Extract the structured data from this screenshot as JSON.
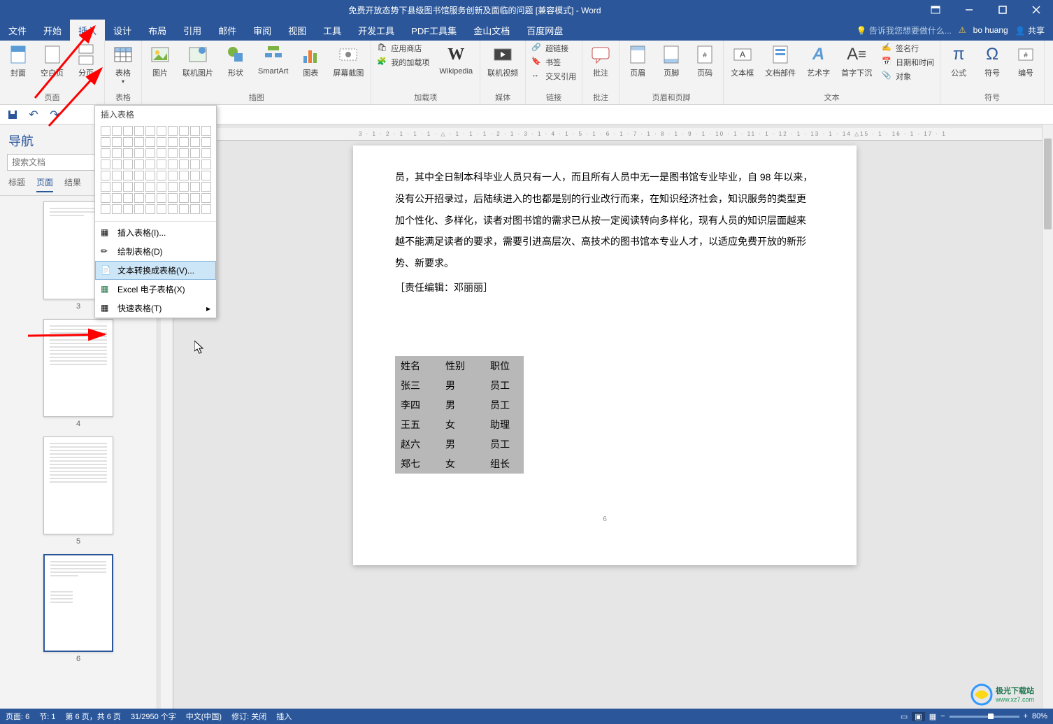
{
  "titlebar": {
    "title": "免费开放态势下县级图书馆服务创新及面临的问题 [兼容模式] - Word"
  },
  "user": {
    "name": "bo huang",
    "share": "共享"
  },
  "menu": {
    "tabs": [
      "文件",
      "开始",
      "插入",
      "设计",
      "布局",
      "引用",
      "邮件",
      "审阅",
      "视图",
      "工具",
      "开发工具",
      "PDF工具集",
      "金山文档",
      "百度网盘"
    ],
    "active_index": 2,
    "tell_me": "告诉我您想要做什么..."
  },
  "ribbon": {
    "groups": {
      "pages": {
        "label": "页面",
        "cover": "封面",
        "blank": "空白页",
        "break": "分页"
      },
      "tables": {
        "label": "表格",
        "table": "表格"
      },
      "illustrations": {
        "label": "插图",
        "picture": "图片",
        "online_pic": "联机图片",
        "shapes": "形状",
        "smartart": "SmartArt",
        "chart": "图表",
        "screenshot": "屏幕截图"
      },
      "addins": {
        "label": "加载项",
        "store": "应用商店",
        "my_addins": "我的加载项",
        "wikipedia": "Wikipedia"
      },
      "media": {
        "label": "媒体",
        "online_video": "联机视频"
      },
      "links": {
        "label": "链接",
        "hyperlink": "超链接",
        "bookmark": "书签",
        "crossref": "交叉引用"
      },
      "comments": {
        "label": "批注",
        "comment": "批注"
      },
      "header_footer": {
        "label": "页眉和页脚",
        "header": "页眉",
        "footer": "页脚",
        "pagenum": "页码"
      },
      "text": {
        "label": "文本",
        "textbox": "文本框",
        "quickparts": "文档部件",
        "wordart": "艺术字",
        "dropcap": "首字下沉",
        "sigline": "签名行",
        "datetime": "日期和时间",
        "object": "对象"
      },
      "symbols": {
        "label": "符号",
        "equation": "公式",
        "symbol": "符号",
        "number": "编号"
      }
    }
  },
  "table_dropdown": {
    "title": "插入表格",
    "insert_table": "插入表格(I)...",
    "draw_table": "绘制表格(D)",
    "convert_text": "文本转换成表格(V)...",
    "excel": "Excel 电子表格(X)",
    "quick_tables": "快速表格(T)"
  },
  "nav": {
    "title": "导航",
    "search_placeholder": "搜索文档",
    "tabs": [
      "标题",
      "页面",
      "结果"
    ],
    "active_tab": 1,
    "pages": [
      3,
      4,
      5,
      6
    ],
    "selected_page": 6
  },
  "document": {
    "paragraphs": [
      "员，其中全日制本科毕业人员只有一人，而且所有人员中无一是图书馆专业毕业，自 98 年以来，没有公开招录过，后陆续进入的也都是别的行业改行而来，在知识经济社会，知识服务的类型更加个性化、多样化，读者对图书馆的需求已从按一定阅读转向多样化，现有人员的知识层面越来越不能满足读者的要求，需要引进高层次、高技术的图书馆本专业人才，以适应免费开放的新形势、新要求。"
    ],
    "editor_note": "［责任编辑：邓丽丽］",
    "table_data": {
      "headers": [
        "姓名",
        "性别",
        "职位"
      ],
      "rows": [
        [
          "张三",
          "男",
          "员工"
        ],
        [
          "李四",
          "男",
          "员工"
        ],
        [
          "王五",
          "女",
          "助理"
        ],
        [
          "赵六",
          "男",
          "员工"
        ],
        [
          "郑七",
          "女",
          "组长"
        ]
      ]
    },
    "page_number": "6"
  },
  "ruler": {
    "marks": "3 · 1 · 2 · 1 · 1 · 1 · △ · 1 · 1 · 1 · 2 · 1 · 3 · 1 · 4 · 1 · 5 · 1 · 6 · 1 · 7 · 1 · 8 · 1 · 9 · 1 · 10 · 1 · 11 · 1 · 12 · 1 · 13 · 1 · 14 △15 · 1 · 16 · 1 · 17 · 1"
  },
  "statusbar": {
    "page": "页面: 6",
    "section": "节: 1",
    "page_of": "第 6 页，共 6 页",
    "words": "31/2950 个字",
    "language": "中文(中国)",
    "track": "修订: 关闭",
    "insert": "插入",
    "zoom": "80%"
  },
  "watermark": {
    "text": "极光下载站",
    "url": "www.xz7.com"
  }
}
